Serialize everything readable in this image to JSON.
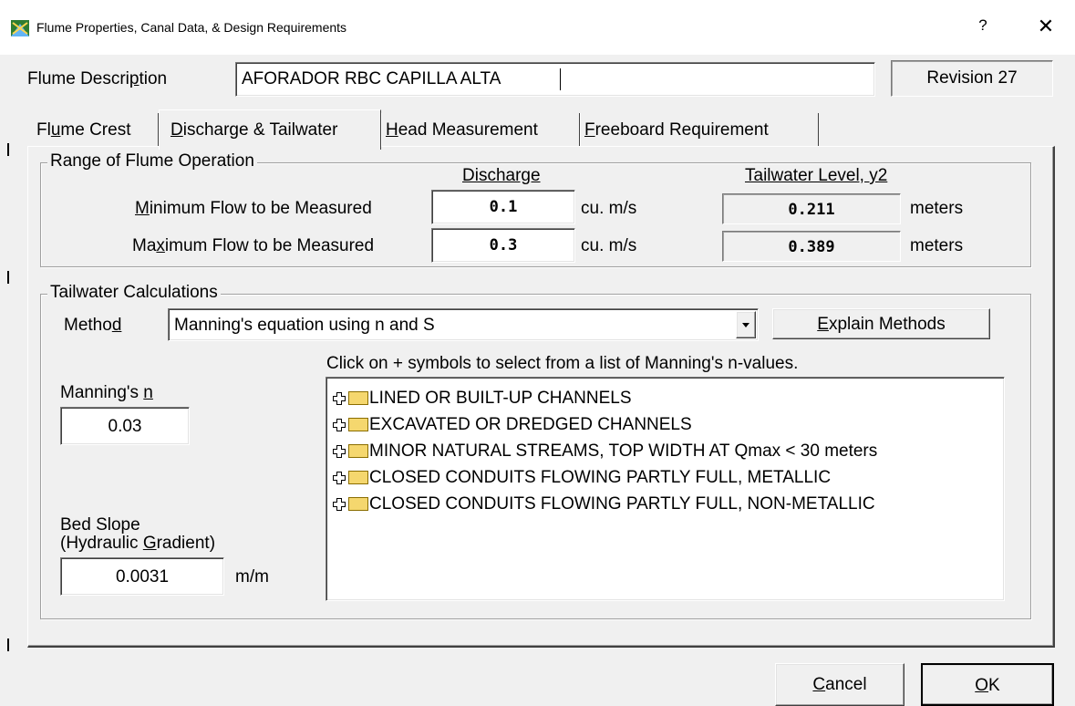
{
  "window": {
    "title": "Flume Properties, Canal Data, & Design Requirements",
    "help_glyph": "?",
    "close_glyph": "✕"
  },
  "header": {
    "description_label_pre": "Flume Descri",
    "description_label_key": "p",
    "description_label_post": "tion",
    "description_value": "AFORADOR RBC CAPILLA ALTA",
    "revision": "Revision 27"
  },
  "tabs": [
    {
      "pre": "Fl",
      "key": "u",
      "post": "me Crest"
    },
    {
      "pre": "",
      "key": "D",
      "post": "ischarge & Tailwater"
    },
    {
      "pre": "",
      "key": "H",
      "post": "ead Measurement"
    },
    {
      "pre": "",
      "key": "F",
      "post": "reeboard Requirement"
    }
  ],
  "range": {
    "legend": "Range of Flume Operation",
    "discharge_header": "Discharge",
    "tailwater_header": "Tailwater Level, y2",
    "min_label_key": "M",
    "min_label_post": "inimum Flow to be Measured",
    "max_label_pre": "Ma",
    "max_label_key": "x",
    "max_label_post": "imum Flow to be Measured",
    "min_discharge": "0.1",
    "max_discharge": "0.3",
    "discharge_unit": "cu. m/s",
    "min_tailwater": "0.211",
    "max_tailwater": "0.389",
    "tailwater_unit": "meters"
  },
  "tailwater": {
    "legend": "Tailwater Calculations",
    "method_label_pre": "Metho",
    "method_label_key": "d",
    "method_value": "Manning's equation using n and S",
    "explain_key": "E",
    "explain_post": "xplain Methods",
    "hint": "Click on + symbols to select from a list of Manning's n-values.",
    "mannings_label_pre": "Manning's ",
    "mannings_label_key": "n",
    "mannings_value": "0.03",
    "bed_slope_label1": "Bed Slope",
    "bed_slope_label2_pre": "(Hydraulic ",
    "bed_slope_label2_key": "G",
    "bed_slope_label2_post": "radient)",
    "bed_slope_value": "0.0031",
    "bed_slope_unit": "m/m",
    "tree": [
      "LINED OR BUILT-UP CHANNELS",
      "EXCAVATED OR DREDGED CHANNELS",
      "MINOR NATURAL STREAMS, TOP WIDTH AT Qmax < 30 meters",
      "CLOSED CONDUITS FLOWING PARTLY FULL, METALLIC",
      "CLOSED CONDUITS FLOWING PARTLY FULL, NON-METALLIC"
    ]
  },
  "footer": {
    "cancel_key": "C",
    "cancel_post": "ancel",
    "ok_key": "O",
    "ok_post": "K"
  }
}
